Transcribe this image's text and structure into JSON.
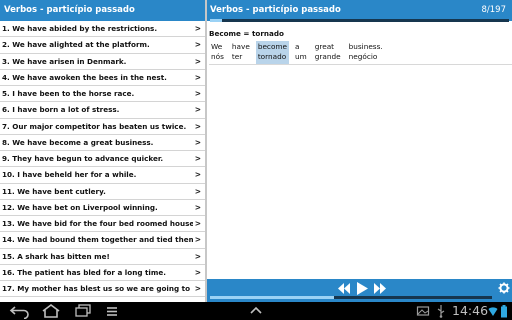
{
  "left_panel": {
    "title": "Verbos - particípio passado",
    "items": [
      {
        "label": "1. We have abided by the restrictions.",
        "chevron": ">"
      },
      {
        "label": "2. We have alighted at the platform.",
        "chevron": ">"
      },
      {
        "label": "3. We have arisen in Denmark.",
        "chevron": ">"
      },
      {
        "label": "4. We have awoken the bees in the nest.",
        "chevron": ">"
      },
      {
        "label": "5. I have been to the horse race.",
        "chevron": ">"
      },
      {
        "label": "6. I have born a lot of stress.",
        "chevron": ">"
      },
      {
        "label": "7. Our major competitor has beaten us twice.",
        "chevron": ">"
      },
      {
        "label": "8. We have become a great business.",
        "chevron": ">"
      },
      {
        "label": "9. They have begun to advance quicker.",
        "chevron": ">"
      },
      {
        "label": "10. I have beheld her for a while.",
        "chevron": ">"
      },
      {
        "label": "11. We have bent cutlery.",
        "chevron": ">"
      },
      {
        "label": "12. We have bet on Liverpool winning.",
        "chevron": ">"
      },
      {
        "label": "13. We have bid for the four bed roomed house.",
        "chevron": ">"
      },
      {
        "label": "14. We had bound them together and tied them to a ...",
        "chevron": ">"
      },
      {
        "label": "15. A shark has bitten me!",
        "chevron": ">"
      },
      {
        "label": "16. The patient has bled for a long time.",
        "chevron": ">"
      },
      {
        "label": "17. My mother has blest us so we are going to marry.",
        "chevron": ">"
      }
    ]
  },
  "right_panel": {
    "title": "Verbos - particípio passado",
    "counter": "8/197",
    "progress_fraction": 0.04,
    "equation": "Become = tornado",
    "words": [
      {
        "en": "We",
        "pt": "nós",
        "highlighted": false
      },
      {
        "en": "have",
        "pt": "ter",
        "highlighted": false
      },
      {
        "en": "become",
        "pt": "tornado",
        "highlighted": true
      },
      {
        "en": "a",
        "pt": "um",
        "highlighted": false
      },
      {
        "en": "great",
        "pt": "grande",
        "highlighted": false
      },
      {
        "en": "business.",
        "pt": "negócio",
        "highlighted": false
      }
    ]
  },
  "player": {
    "progress_fraction": 0.44,
    "buttons": [
      "rewind-icon",
      "play-icon",
      "fast-forward-icon",
      "settings-icon"
    ]
  },
  "system_bar": {
    "time": "14:46",
    "nav_icons": [
      "back-icon",
      "home-icon",
      "recent-apps-icon",
      "menu-icon",
      "up-arrow-icon"
    ],
    "status_icons": [
      "gallery-icon",
      "usb-icon",
      "wifi-icon",
      "battery-icon"
    ]
  },
  "colors": {
    "accent": "#2a87c8",
    "highlight": "#b9d4ea",
    "progress_track": "#16364f",
    "progress_fill": "#9bd2f5"
  }
}
